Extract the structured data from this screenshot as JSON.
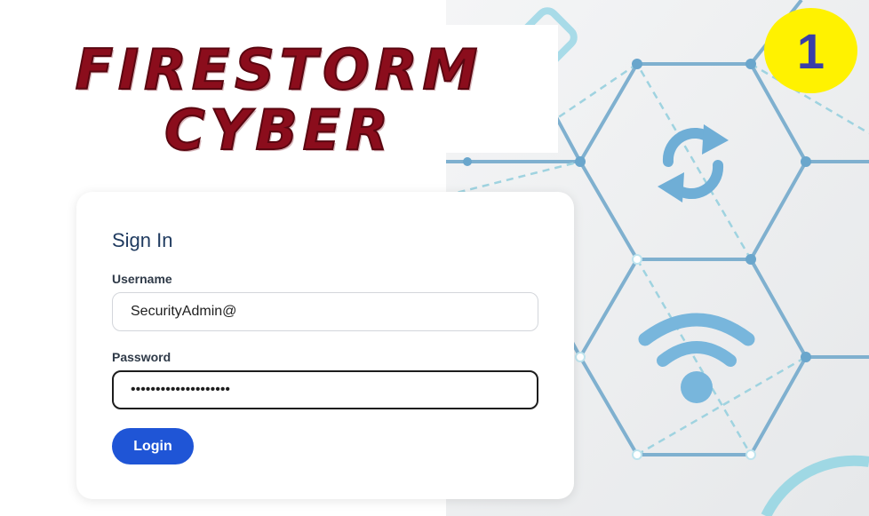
{
  "logo": {
    "line1": "FIRESTORM",
    "line2": "CYBER"
  },
  "badge": {
    "number": "1"
  },
  "signin": {
    "title": "Sign In",
    "username_label": "Username",
    "username_value": "SecurityAdmin@",
    "password_label": "Password",
    "password_value": "••••••••••••••••••••",
    "login_label": "Login"
  },
  "colors": {
    "logo": "#8b0d1c",
    "badge": "#fff200",
    "badge_text": "#3a3ea8",
    "login_button": "#1f55d6",
    "title": "#1f3a5f"
  },
  "icons": [
    "refresh-icon",
    "wifi-icon"
  ]
}
